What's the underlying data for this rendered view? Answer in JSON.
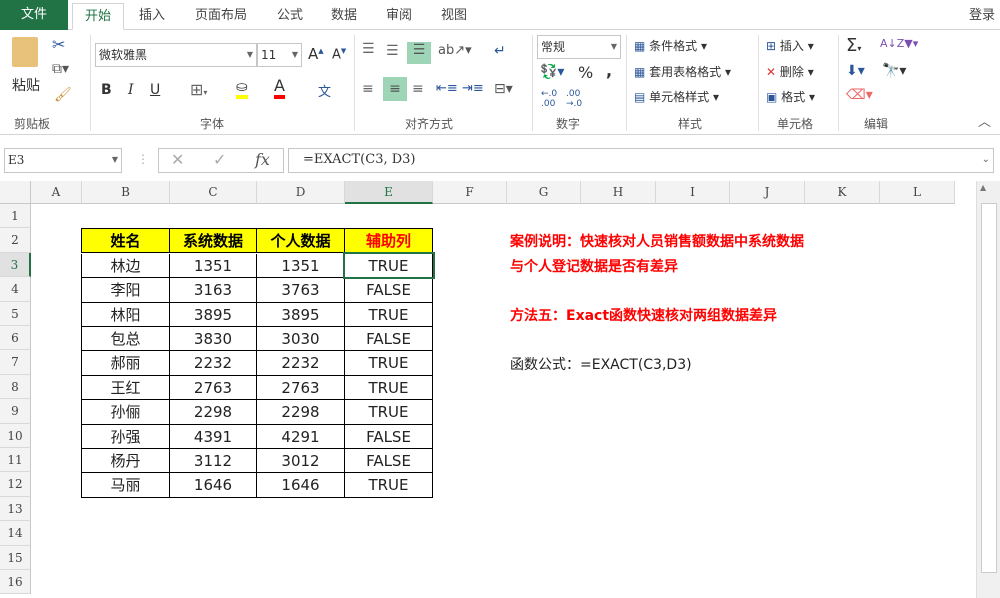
{
  "tabs": {
    "file": "文件",
    "home": "开始",
    "insert": "插入",
    "layout": "页面布局",
    "formulas": "公式",
    "data": "数据",
    "review": "审阅",
    "view": "视图",
    "login": "登录"
  },
  "ribbon": {
    "clipboard": {
      "paste": "粘贴",
      "label": "剪贴板"
    },
    "font": {
      "name": "微软雅黑",
      "size": "11",
      "bold": "B",
      "italic": "I",
      "underline": "U",
      "label": "字体",
      "phonetic": "文"
    },
    "alignment": {
      "label": "对齐方式"
    },
    "number": {
      "format": "常规",
      "percent": "%",
      "comma": ",",
      "label": "数字"
    },
    "styles": {
      "conditional": "条件格式",
      "table": "套用表格格式",
      "cell": "单元格样式",
      "label": "样式"
    },
    "cells": {
      "insert": "插入",
      "delete": "删除",
      "format": "格式",
      "label": "单元格"
    },
    "editing": {
      "label": "编辑"
    }
  },
  "formula_bar": {
    "name_box": "E3",
    "formula": "=EXACT(C3, D3)",
    "fx": "fx"
  },
  "columns": [
    "A",
    "B",
    "C",
    "D",
    "E",
    "F",
    "G",
    "H",
    "I",
    "J",
    "K",
    "L"
  ],
  "rows": [
    "1",
    "2",
    "3",
    "4",
    "5",
    "6",
    "7",
    "8",
    "9",
    "10",
    "11",
    "12",
    "13",
    "14",
    "15",
    "16"
  ],
  "table": {
    "headers": [
      "姓名",
      "系统数据",
      "个人数据",
      "辅助列"
    ],
    "rows": [
      [
        "林边",
        "1351",
        "1351",
        "TRUE"
      ],
      [
        "李阳",
        "3163",
        "3763",
        "FALSE"
      ],
      [
        "林阳",
        "3895",
        "3895",
        "TRUE"
      ],
      [
        "包总",
        "3830",
        "3030",
        "FALSE"
      ],
      [
        "郝丽",
        "2232",
        "2232",
        "TRUE"
      ],
      [
        "王红",
        "2763",
        "2763",
        "TRUE"
      ],
      [
        "孙俪",
        "2298",
        "2298",
        "TRUE"
      ],
      [
        "孙强",
        "4391",
        "4291",
        "FALSE"
      ],
      [
        "杨丹",
        "3112",
        "3012",
        "FALSE"
      ],
      [
        "马丽",
        "1646",
        "1646",
        "TRUE"
      ]
    ]
  },
  "notes": {
    "line1": "案例说明：快速核对人员销售额数据中系统数据",
    "line2": "与个人登记数据是否有差异",
    "method": "方法五：Exact函数快速核对两组数据差异",
    "formula": "函数公式：=EXACT(C3,D3)"
  },
  "colors": {
    "accent": "#217346",
    "header_fill": "#ffff00",
    "red": "#ff0000"
  }
}
